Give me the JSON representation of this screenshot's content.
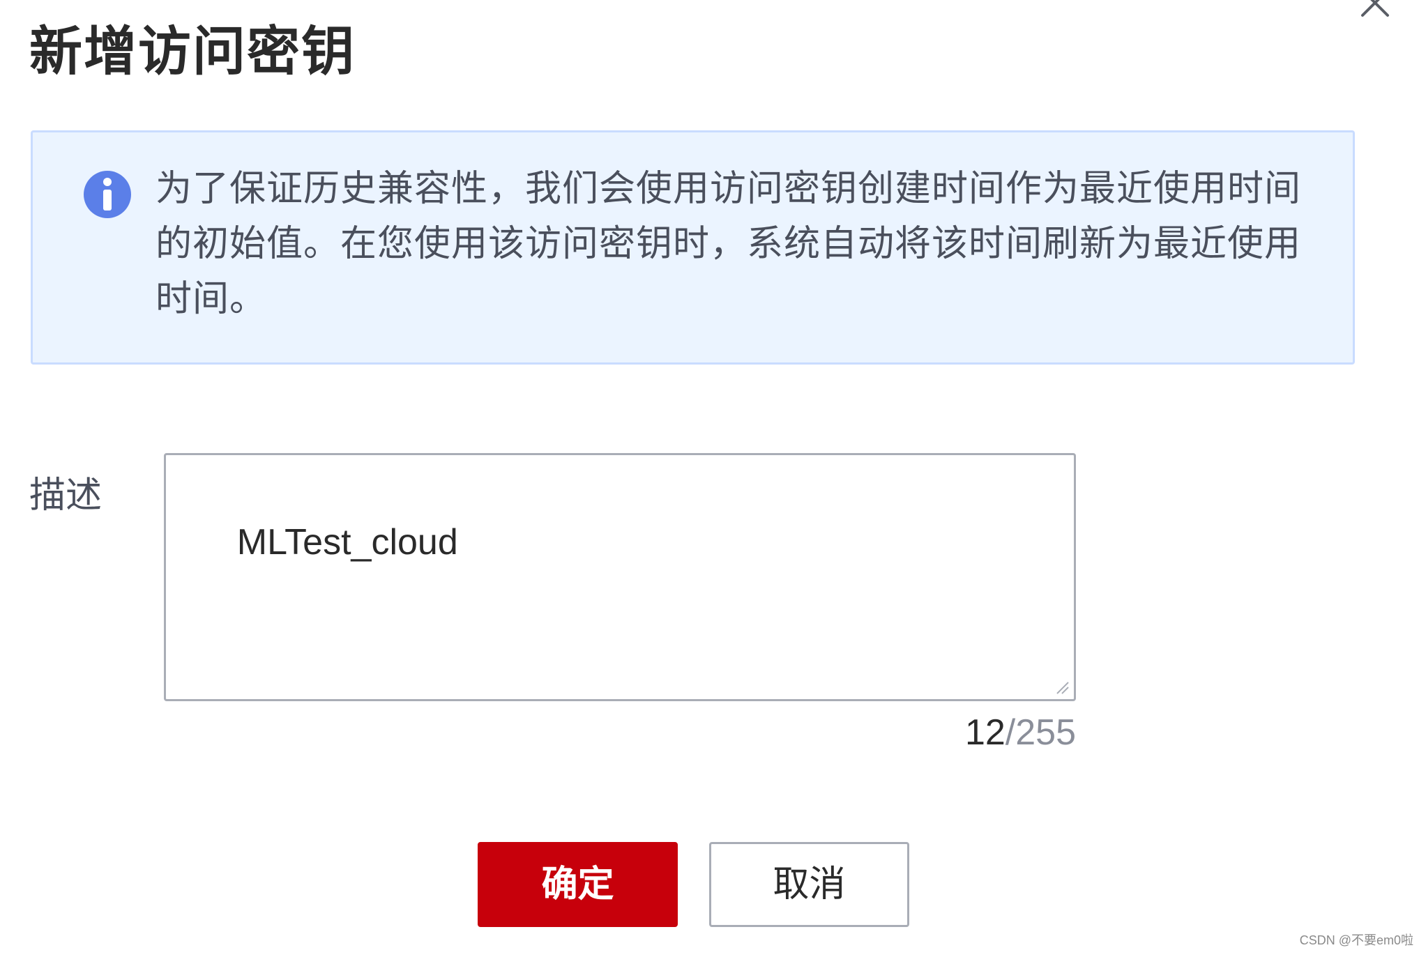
{
  "dialog": {
    "title": "新增访问密钥",
    "close_icon": "close-icon",
    "info": {
      "icon": "info-icon",
      "icon_color": "#5b7fe8",
      "text": "为了保证历史兼容性，我们会使用访问密钥创建时间作为最近使用时间的初始值。在您使用该访问密钥时，系统自动将该时间刷新为最近使用时间。"
    },
    "description": {
      "label": "描述",
      "value": "MLTest_cloud",
      "count_current": "12",
      "count_max": "/255"
    },
    "buttons": {
      "ok_label": "确定",
      "cancel_label": "取消"
    }
  },
  "colors": {
    "primary": "#c7000b",
    "info_bg": "#ebf4ff",
    "info_border": "#c9dcff"
  },
  "watermark": "CSDN @不要em0啦"
}
